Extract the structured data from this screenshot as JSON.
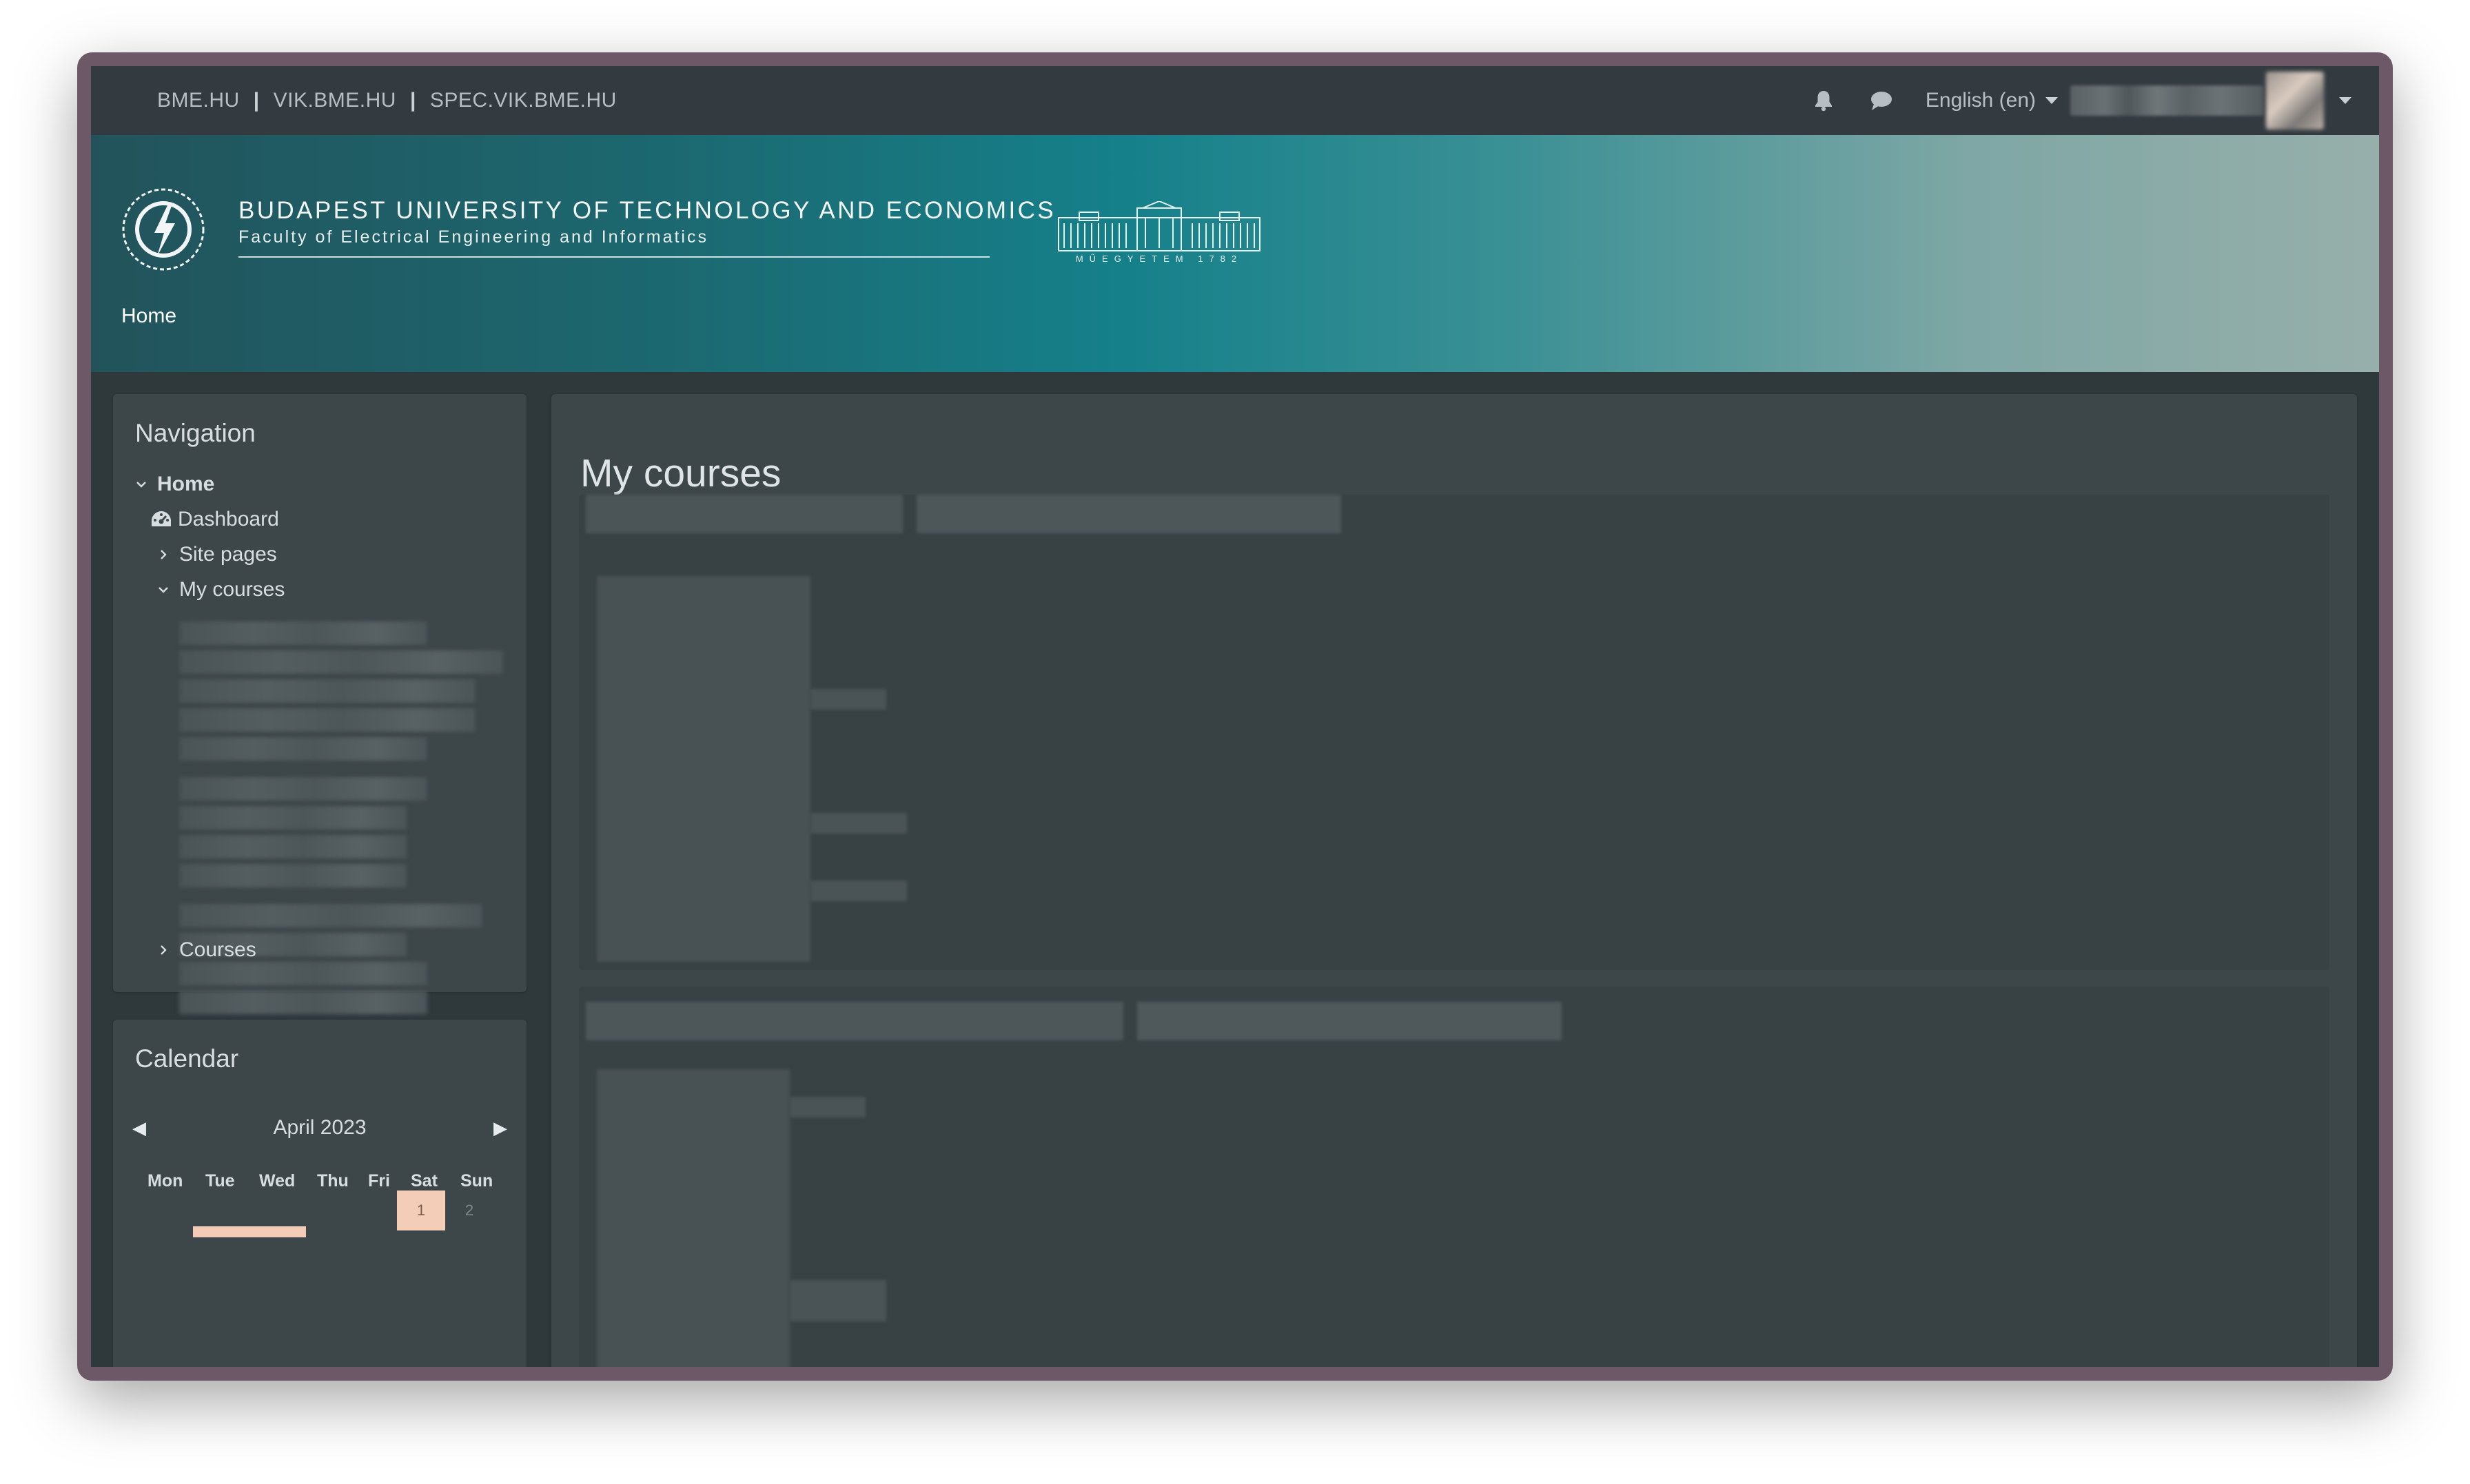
{
  "topbar": {
    "links": [
      "BME.HU",
      "VIK.BME.HU",
      "SPEC.VIK.BME.HU"
    ],
    "separator": "|",
    "language": "English (en)",
    "icons": [
      "bell-icon",
      "chat-icon"
    ]
  },
  "banner": {
    "university": "BUDAPEST UNIVERSITY OF TECHNOLOGY AND ECONOMICS",
    "faculty": "Faculty of Electrical Engineering and Informatics",
    "building_caption": "MŰEGYETEM 1782",
    "home": "Home"
  },
  "navigation": {
    "title": "Navigation",
    "home": "Home",
    "dashboard": "Dashboard",
    "site_pages": "Site pages",
    "my_courses": "My courses",
    "courses": "Courses"
  },
  "calendar": {
    "title": "Calendar",
    "month": "April 2023",
    "prev_arrow": "◀",
    "next_arrow": "▶",
    "days": [
      "Mon",
      "Tue",
      "Wed",
      "Thu",
      "Fri",
      "Sat",
      "Sun"
    ],
    "dates": [
      "1",
      "2"
    ]
  },
  "main": {
    "title": "My courses"
  },
  "colors": {
    "topbar": "#343b40",
    "page_bg": "#2f393c",
    "block_bg": "#3d4649",
    "today_highlight": "#f4cdb8",
    "banner_teal": "#15808a"
  }
}
